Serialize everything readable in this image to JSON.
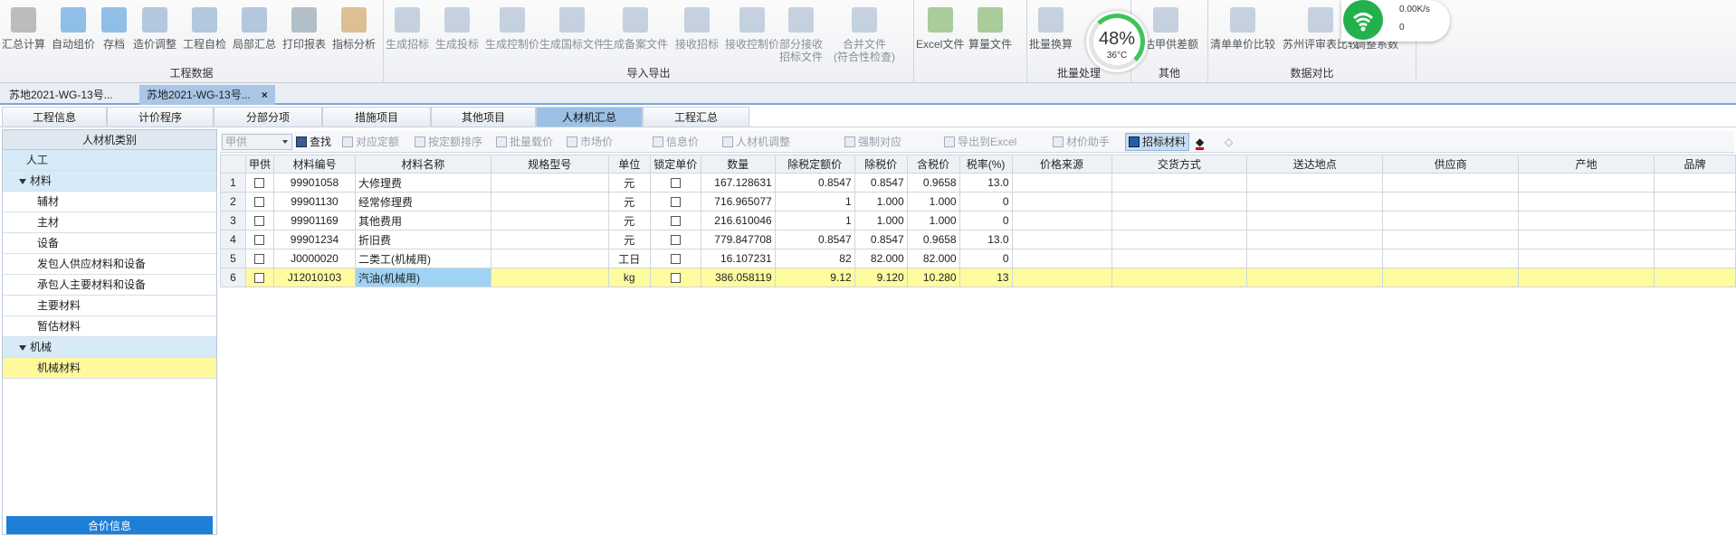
{
  "ribbon": {
    "groups": [
      {
        "label": "工程数据",
        "buttons": [
          "汇总计算",
          "自动组价",
          "存档",
          "造价调整",
          "工程自检",
          "局部汇总",
          "打印报表",
          "指标分析"
        ]
      },
      {
        "label": "导入导出",
        "buttons": [
          "生成招标",
          "生成投标",
          "生成控制价",
          "生成国标文件",
          "生成备案文件",
          "接收招标",
          "接收控制价",
          "部分接收\n招标文件",
          "合并文件\n(符合性检查)"
        ]
      },
      {
        "label": "",
        "buttons": [
          "Excel文件",
          "算量文件"
        ]
      },
      {
        "label": "批量处理",
        "buttons": [
          "批量换算"
        ]
      },
      {
        "label": "其他",
        "buttons": [
          "暂估甲供差额"
        ]
      },
      {
        "label": "数据对比",
        "buttons": [
          "清单单价比较",
          "苏州评审表比较",
          "调整系数"
        ]
      }
    ]
  },
  "widget": {
    "percent": "48%",
    "temp": "36°C",
    "net_speed": "0.00K/s",
    "net_count": "0"
  },
  "doc_tabs": [
    {
      "label": "苏地2021-WG-13号..."
    },
    {
      "label": "苏地2021-WG-13号...",
      "close": "×"
    }
  ],
  "module_tabs": [
    "工程信息",
    "计价程序",
    "分部分项",
    "措施项目",
    "其他项目",
    "人材机汇总",
    "工程汇总"
  ],
  "left_panel": {
    "header": "人材机类别",
    "items": [
      {
        "label": "人工",
        "level": 0
      },
      {
        "label": "材料",
        "level": 0,
        "expanded": true
      },
      {
        "label": "辅材",
        "level": 1
      },
      {
        "label": "主材",
        "level": 1
      },
      {
        "label": "设备",
        "level": 1
      },
      {
        "label": "发包人供应材料和设备",
        "level": 1
      },
      {
        "label": "承包人主要材料和设备",
        "level": 1
      },
      {
        "label": "主要材料",
        "level": 1
      },
      {
        "label": "暂估材料",
        "level": 1
      },
      {
        "label": "机械",
        "level": 0,
        "expanded": true
      },
      {
        "label": "机械材料",
        "level": 1,
        "selected": true
      }
    ],
    "footer": "合价信息"
  },
  "toolbar": {
    "combo": "甲供",
    "find": "查找",
    "items": [
      "对应定额",
      "按定额排序",
      "批量载价",
      "市场价",
      "信息价",
      "人材机调整",
      "强制对应",
      "导出到Excel",
      "材价助手",
      "招标材料"
    ]
  },
  "table": {
    "headers": [
      "",
      "甲供",
      "材料编号",
      "材料名称",
      "规格型号",
      "单位",
      "锁定单价",
      "数量",
      "除税定额价",
      "除税价",
      "含税价",
      "税率(%)",
      "价格来源",
      "交货方式",
      "送达地点",
      "供应商",
      "产地",
      "品牌"
    ],
    "rows": [
      {
        "no": "1",
        "code": "99901058",
        "name": "大修理费",
        "spec": "",
        "unit": "元",
        "qty": "167.128631",
        "base": "0.8547",
        "price": "0.8547",
        "tax_price": "0.9658",
        "rate": "13.0"
      },
      {
        "no": "2",
        "code": "99901130",
        "name": "经常修理费",
        "spec": "",
        "unit": "元",
        "qty": "716.965077",
        "base": "1",
        "price": "1.000",
        "tax_price": "1.000",
        "rate": "0"
      },
      {
        "no": "3",
        "code": "99901169",
        "name": "其他费用",
        "spec": "",
        "unit": "元",
        "qty": "216.610046",
        "base": "1",
        "price": "1.000",
        "tax_price": "1.000",
        "rate": "0"
      },
      {
        "no": "4",
        "code": "99901234",
        "name": "折旧费",
        "spec": "",
        "unit": "元",
        "qty": "779.847708",
        "base": "0.8547",
        "price": "0.8547",
        "tax_price": "0.9658",
        "rate": "13.0"
      },
      {
        "no": "5",
        "code": "J0000020",
        "name": "二类工(机械用)",
        "spec": "",
        "unit": "工日",
        "qty": "16.107231",
        "base": "82",
        "price": "82.000",
        "tax_price": "82.000",
        "rate": "0"
      },
      {
        "no": "6",
        "code": "J12010103",
        "name": "汽油(机械用)",
        "spec": "",
        "unit": "kg",
        "qty": "386.058119",
        "base": "9.12",
        "price": "9.120",
        "tax_price": "10.280",
        "rate": "13",
        "selected": true
      }
    ]
  }
}
